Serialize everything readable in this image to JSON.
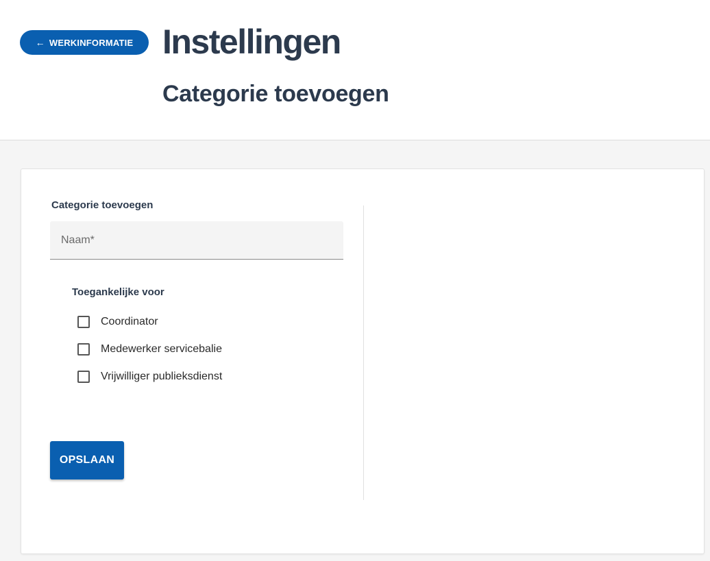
{
  "header": {
    "back_button_label": "WERKINFORMATIE",
    "title": "Instellingen",
    "subtitle": "Categorie toevoegen"
  },
  "form": {
    "section_label": "Categorie toevoegen",
    "name_field": {
      "value": "",
      "placeholder": "Naam*"
    },
    "access_label": "Toegankelijke voor",
    "roles": [
      {
        "label": "Coordinator",
        "checked": false
      },
      {
        "label": "Medewerker servicebalie",
        "checked": false
      },
      {
        "label": "Vrijwilliger publieksdienst",
        "checked": false
      }
    ],
    "save_label": "OPSLAAN"
  },
  "colors": {
    "accent": "#0a5fb0",
    "title_text": "#2c3a4d",
    "background": "#f5f5f5"
  },
  "icons": {
    "back": "arrow-left-icon"
  }
}
